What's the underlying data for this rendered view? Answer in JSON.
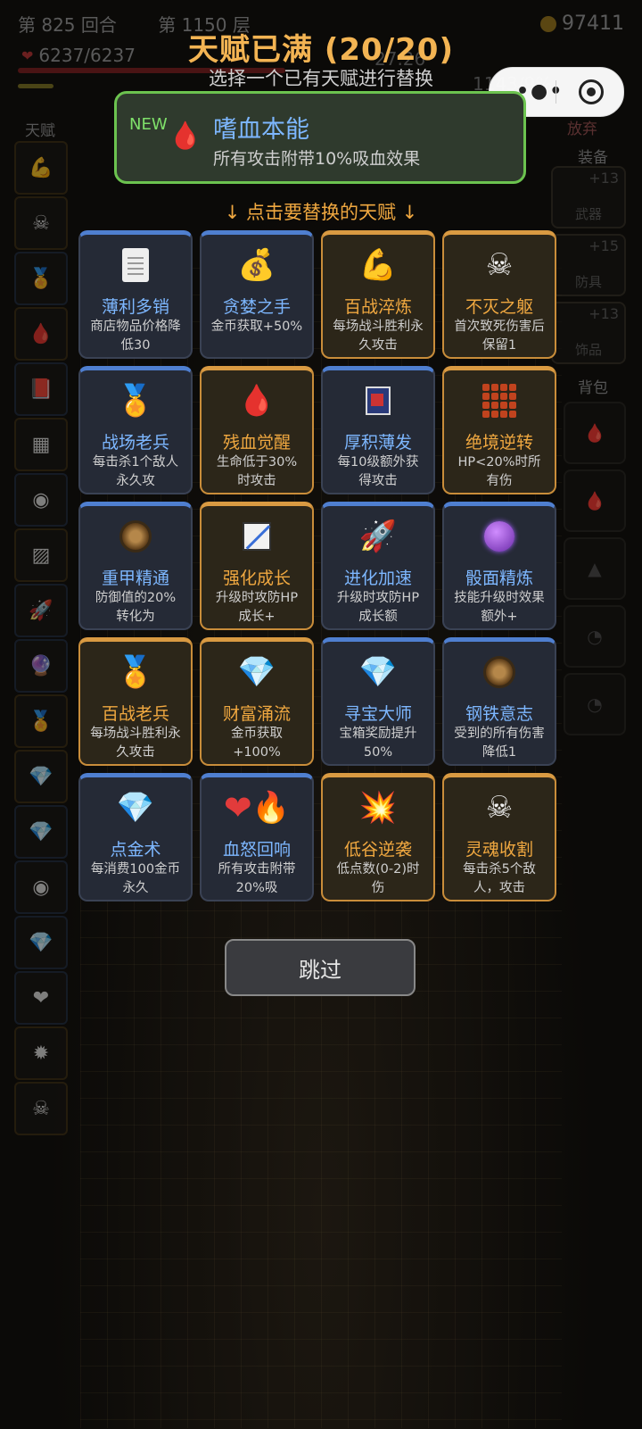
{
  "background": {
    "round_label": "第 825 回合",
    "floor_label": "第 1150 层",
    "hp": "6237/6237",
    "gold": "97411",
    "stat_a": "27.26",
    "stat_b": "1143/9%",
    "talent_label": "天赋",
    "abandon_label": "放弃",
    "equip_label": "装备",
    "bag_label": "背包",
    "equip_slots": [
      {
        "name": "武器",
        "plus": "+13"
      },
      {
        "name": "防具",
        "plus": "+15"
      },
      {
        "name": "饰品",
        "plus": "+13"
      }
    ]
  },
  "dialog": {
    "title": "天赋已满 (20/20)",
    "subtitle": "选择一个已有天赋进行替换",
    "new_talent": {
      "tag": "NEW",
      "icon": "blood-drop-icon",
      "name": "嗜血本能",
      "desc": "所有攻击附带10%吸血效果"
    },
    "hint": "↓ 点击要替换的天赋 ↓",
    "skip_label": "跳过"
  },
  "talents": [
    {
      "name": "薄利多销",
      "desc": "商店物品价格降低30",
      "rarity": "rare",
      "icon": "receipt-icon"
    },
    {
      "name": "贪婪之手",
      "desc": "金币获取+50%",
      "rarity": "rare",
      "icon": "money-bag-icon"
    },
    {
      "name": "百战淬炼",
      "desc": "每场战斗胜利永久攻击",
      "rarity": "epic",
      "icon": "flexed-arm-icon"
    },
    {
      "name": "不灭之躯",
      "desc": "首次致死伤害后保留1",
      "rarity": "epic",
      "icon": "skull-crossbones-icon"
    },
    {
      "name": "战场老兵",
      "desc": "每击杀1个敌人永久攻",
      "rarity": "rare",
      "icon": "medal-icon"
    },
    {
      "name": "残血觉醒",
      "desc": "生命低于30%时攻击",
      "rarity": "epic",
      "icon": "blood-drop-icon"
    },
    {
      "name": "厚积薄发",
      "desc": "每10级额外获得攻击",
      "rarity": "rare",
      "icon": "book-icon"
    },
    {
      "name": "绝境逆转",
      "desc": "HP<20%时所有伤",
      "rarity": "epic",
      "icon": "tile-grid-icon"
    },
    {
      "name": "重甲精通",
      "desc": "防御值的20%转化为",
      "rarity": "rare",
      "icon": "shield-icon"
    },
    {
      "name": "强化成长",
      "desc": "升级时攻防HP成长+",
      "rarity": "epic",
      "icon": "ruler-icon"
    },
    {
      "name": "进化加速",
      "desc": "升级时攻防HP成长额",
      "rarity": "rare",
      "icon": "rocket-icon"
    },
    {
      "name": "骰面精炼",
      "desc": "技能升级时效果额外+",
      "rarity": "rare",
      "icon": "crystal-ball-icon"
    },
    {
      "name": "百战老兵",
      "desc": "每场战斗胜利永久攻击",
      "rarity": "epic",
      "icon": "medal-icon"
    },
    {
      "name": "财富涌流",
      "desc": "金币获取+100%",
      "rarity": "epic",
      "icon": "diamond-icon"
    },
    {
      "name": "寻宝大师",
      "desc": "宝箱奖励提升50%",
      "rarity": "rare",
      "icon": "diamond-icon"
    },
    {
      "name": "钢铁意志",
      "desc": "受到的所有伤害降低1",
      "rarity": "rare",
      "icon": "shield-icon"
    },
    {
      "name": "点金术",
      "desc": "每消费100金币永久",
      "rarity": "rare",
      "icon": "diamond-icon"
    },
    {
      "name": "血怒回响",
      "desc": "所有攻击附带20%吸",
      "rarity": "rare",
      "icon": "heart-fire-icon"
    },
    {
      "name": "低谷逆袭",
      "desc": "低点数(0-2)时伤",
      "rarity": "epic",
      "icon": "explosion-icon"
    },
    {
      "name": "灵魂收割",
      "desc": "每击杀5个敌人，攻击",
      "rarity": "epic",
      "icon": "skull-crossbones-icon"
    }
  ]
}
